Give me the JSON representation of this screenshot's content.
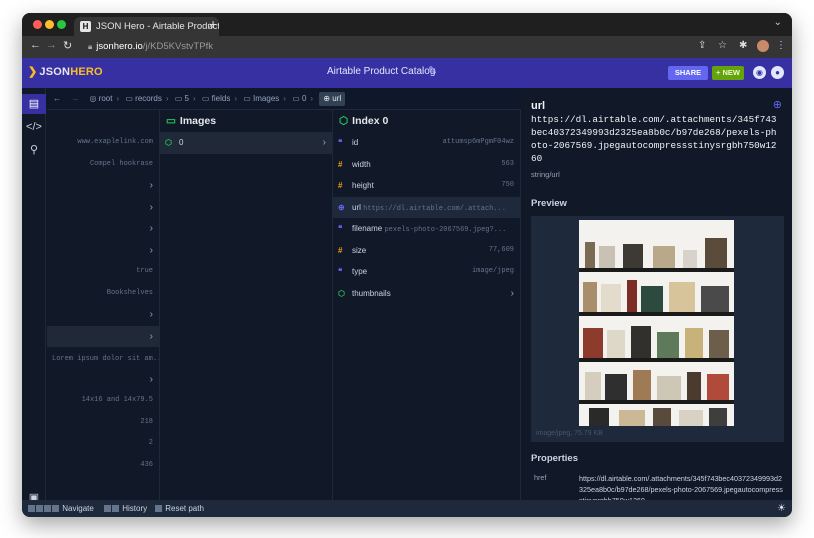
{
  "browser": {
    "tab_title": "JSON Hero - Airtable Product C",
    "tab_favicon": "H",
    "url_host": "jsonhero.io",
    "url_path": "/j/KD5KVstvTPfk"
  },
  "header": {
    "logo_json": "JSON",
    "logo_hero": "HERO",
    "title": "Airtable Product Catalog",
    "share_label": "SHARE",
    "new_label": "+ NEW"
  },
  "breadcrumbs": [
    {
      "icon": "root-icon",
      "label": "root"
    },
    {
      "icon": "folder-icon",
      "label": "records"
    },
    {
      "icon": "folder-icon",
      "label": "5"
    },
    {
      "icon": "folder-icon",
      "label": "fields"
    },
    {
      "icon": "folder-icon",
      "label": "Images"
    },
    {
      "icon": "folder-icon",
      "label": "0"
    },
    {
      "icon": "globe-icon",
      "label": "url"
    }
  ],
  "column0": {
    "rows": [
      "www.exaplelink.com",
      "Compel hookrase",
      "",
      "",
      "",
      "",
      "true",
      "Bookshelves",
      "",
      "",
      "Lorem ipsum dolor sit am...",
      "",
      "14x16 and 14x79.5",
      "218",
      "2",
      "436"
    ]
  },
  "column1": {
    "title": "Images",
    "rows": [
      {
        "key": "0"
      }
    ]
  },
  "column2": {
    "title": "Index 0",
    "rows": [
      {
        "icon": "string",
        "key": "id",
        "value": "attumsp6mPgmF04wz"
      },
      {
        "icon": "number",
        "key": "width",
        "value": "563"
      },
      {
        "icon": "number",
        "key": "height",
        "value": "750"
      },
      {
        "icon": "url",
        "key": "url",
        "value": "https://dl.airtable.com/.attach..."
      },
      {
        "icon": "string",
        "key": "filename",
        "value": "pexels-photo-2067569.jpeg?..."
      },
      {
        "icon": "number",
        "key": "size",
        "value": "77,609"
      },
      {
        "icon": "string",
        "key": "type",
        "value": "image/jpeg"
      },
      {
        "icon": "object",
        "key": "thumbnails",
        "value": ""
      }
    ]
  },
  "panel": {
    "title": "url",
    "value": "https://dl.airtable.com/.attachments/345f743bec40372349993d2325ea8b0c/b97de268/pexels-photo-2067569.jpegautocompressstinysrgbh750w1260",
    "type": "string/url",
    "preview_heading": "Preview",
    "preview_meta": "image/jpeg, 75.79 KB",
    "properties_heading": "Properties",
    "prop_key": "href",
    "prop_value": "https://dl.airtable.com/.attachments/345f743bec40372349993d2325ea8b0c/b97de268/pexels-photo-2067569.jpegautocompressstinysrgbh750w1260"
  },
  "footer": {
    "navigate": "Navigate",
    "history": "History",
    "reset": "Reset path"
  },
  "colors": {
    "accent": "#3730a3",
    "hero": "#fbbf24",
    "new_button": "#65a30d",
    "share_button": "#6366f1"
  }
}
